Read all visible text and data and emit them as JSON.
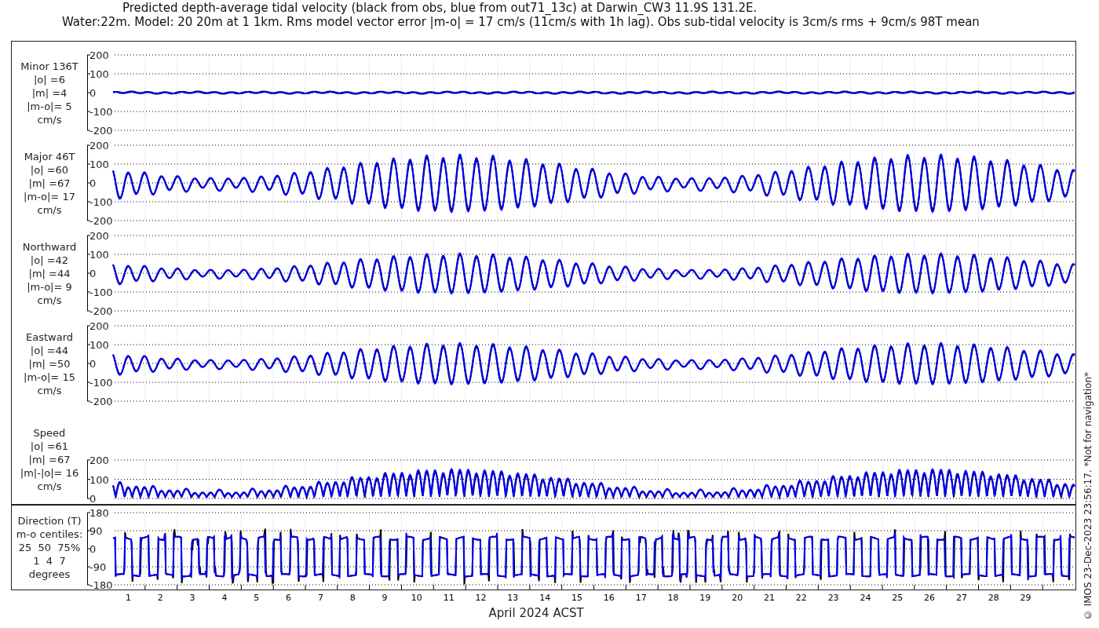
{
  "title": [
    "Predicted depth-average tidal velocity (black from obs, blue from out71_13c) at Darwin_CW3 11.9S 131.2E.",
    "Water:22m. Model: 20 20m at 1 1km. Rms model vector error |m-o| = 17 cm/s (11cm/s with 1h lag). Obs sub-tidal velocity is 3cm/s rms + 9cm/s 98T mean"
  ],
  "panels": [
    {
      "kind": "minor",
      "label": [
        "Minor 136T",
        "|o| =6",
        "|m| =4",
        "|m-o|= 5",
        "cm/s"
      ],
      "yticks": [
        "200",
        "100",
        "0",
        "-100",
        "-200"
      ]
    },
    {
      "kind": "major",
      "label": [
        "Major 46T",
        "|o| =60",
        "|m| =67",
        "|m-o|= 17",
        "cm/s"
      ],
      "yticks": [
        "200",
        "100",
        "0",
        "-100",
        "-200"
      ]
    },
    {
      "kind": "north",
      "label": [
        "Northward",
        "|o| =42",
        "|m| =44",
        "|m-o|= 9",
        "cm/s"
      ],
      "yticks": [
        "200",
        "100",
        "0",
        "-100",
        "-200"
      ]
    },
    {
      "kind": "east",
      "label": [
        "Eastward",
        "|o| =44",
        "|m| =50",
        "|m-o|= 15",
        "cm/s"
      ],
      "yticks": [
        "200",
        "100",
        "0",
        "-100",
        "-200"
      ]
    },
    {
      "kind": "speed",
      "label": [
        "Speed",
        "|o| =61",
        "|m| =67",
        "|m|-|o|= 16",
        "cm/s"
      ],
      "yticks": [
        "200",
        "100",
        "0"
      ]
    },
    {
      "kind": "direction",
      "label": [
        "Direction (T)",
        "m-o centiles:",
        "25  50  75%",
        "1  4  7",
        "degrees"
      ],
      "yticks": [
        "180",
        "90",
        "0",
        "-90",
        "-180"
      ]
    }
  ],
  "x_axis": {
    "days": [
      "1",
      "2",
      "3",
      "4",
      "5",
      "6",
      "7",
      "8",
      "9",
      "10",
      "11",
      "12",
      "13",
      "14",
      "15",
      "16",
      "17",
      "18",
      "19",
      "20",
      "21",
      "22",
      "23",
      "24",
      "25",
      "26",
      "27",
      "28",
      "29"
    ],
    "label": "April 2024 ACST"
  },
  "footer": "© IMOS 23-Dec-2023 23:56:17. *Not for navigation*"
}
